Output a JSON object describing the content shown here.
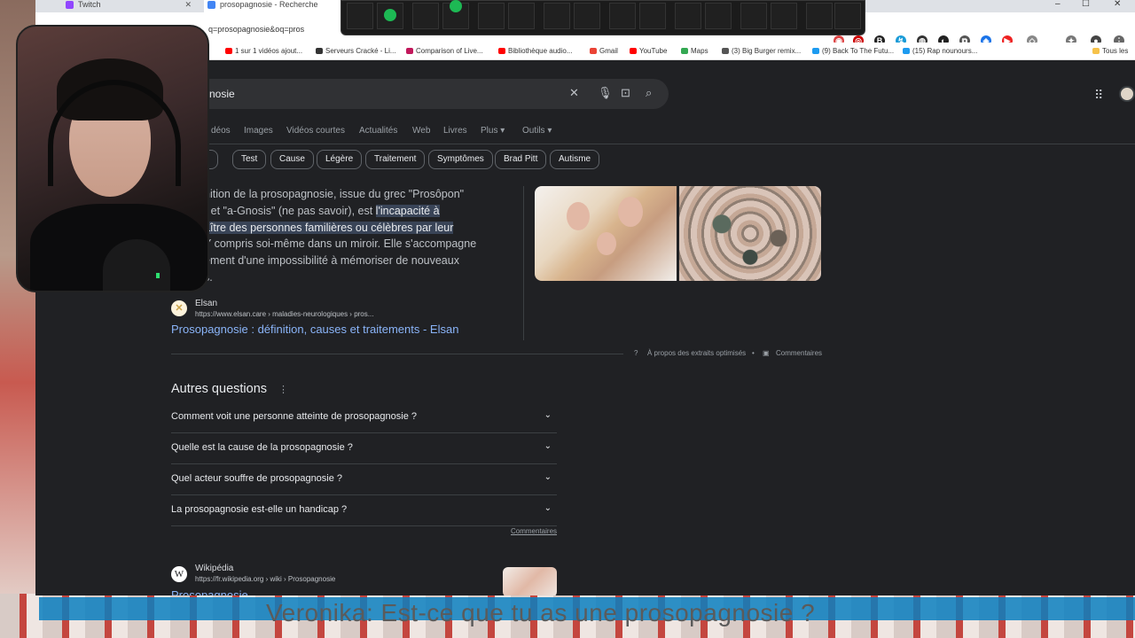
{
  "tabs": [
    {
      "label": "Twitch",
      "color": "#9146ff"
    },
    {
      "label": "prosopagnosie - Recherche",
      "color": "#4285f4"
    }
  ],
  "window_controls": {
    "minimize": "–",
    "maximize": "☐",
    "close": "✕"
  },
  "address_bar": {
    "url": "q=prosopagnosie&oq=pros"
  },
  "bookmarks": [
    {
      "label": "1 sur 1 vidéos ajout...",
      "color": "#ff0000"
    },
    {
      "label": "Serveurs Cracké - Li...",
      "color": "#333333"
    },
    {
      "label": "Comparison of Live...",
      "color": "#c2185b"
    },
    {
      "label": "Bibliothèque audio...",
      "color": "#ff0000"
    },
    {
      "label": "Gmail",
      "color": "#ea4335"
    },
    {
      "label": "YouTube",
      "color": "#ff0000"
    },
    {
      "label": "Maps",
      "color": "#34a853"
    },
    {
      "label": "(3) Big Burger remix...",
      "color": "#555555"
    },
    {
      "label": "(9) Back To The Futu...",
      "color": "#1d9bf0"
    },
    {
      "label": "(15) Rap nounours...",
      "color": "#1d9bf0"
    }
  ],
  "all_bookmarks": "Tous les",
  "search": {
    "query": "nosie"
  },
  "nav_tabs": [
    "déos",
    "Images",
    "Vidéos courtes",
    "Actualités",
    "Web",
    "Livres",
    "Plus ▾",
    "Outils ▾"
  ],
  "chips": [
    "és",
    "Test",
    "Cause",
    "Légère",
    "Traitement",
    "Symptômes",
    "Brad Pitt",
    "Autisme"
  ],
  "snippet": {
    "line1": "nition de la prosopagnosie, issue du grec \"Prosôpon\"",
    "line2_a": ") et \"a-Gnosis\" (ne pas savoir), est ",
    "line2_hl": "l'incapacité à",
    "line3_hl": "aître des personnes familières ou célèbres par leur",
    "line4": " Y compris soi-même dans un miroir. Elle s'accompagne",
    "line5": "ement d'une impossibilité à mémoriser de nouveaux",
    "line6": "s."
  },
  "source": {
    "name": "Elsan",
    "url": "https://www.elsan.care › maladies-neurologiques › pros...",
    "title": "Prosopagnosie : définition, causes et traitements - Elsan"
  },
  "about_extracts": "À propos des extraits optimisés",
  "feedback": "Commentaires",
  "paa": {
    "title": "Autres questions",
    "questions": [
      "Comment voit une personne atteinte de prosopagnosie ?",
      "Quelle est la cause de la prosopagnosie ?",
      "Quel acteur souffre de prosopagnosie ?",
      "La prosopagnosie est-elle un handicap ?"
    ],
    "feedback": "Commentaires"
  },
  "wikipedia": {
    "name": "Wikipédia",
    "url": "https://fr.wikipedia.org › wiki › Prosopagnosie",
    "title": "Prosopagnosie"
  },
  "subtitle": "Veronika: Est-ce que tu as une prosopagnosie ?"
}
